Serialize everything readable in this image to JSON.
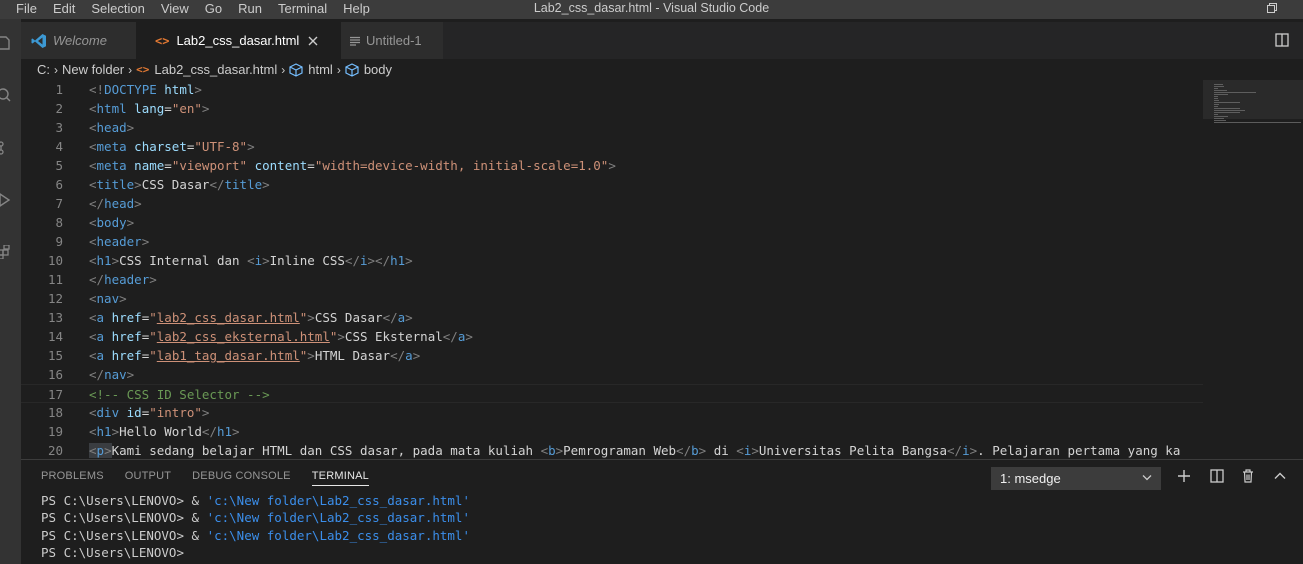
{
  "titlebar": {
    "menu": [
      "File",
      "Edit",
      "Selection",
      "View",
      "Go",
      "Run",
      "Terminal",
      "Help"
    ],
    "window_title": "Lab2_css_dasar.html - Visual Studio Code"
  },
  "tabs": [
    {
      "label": "Welcome",
      "icon": "vscode-logo-icon"
    },
    {
      "label": "Lab2_css_dasar.html",
      "icon": "html-file-icon",
      "active": true
    },
    {
      "label": "Untitled-1",
      "icon": "text-file-icon"
    }
  ],
  "breadcrumb": [
    "C:",
    "New folder",
    "Lab2_css_dasar.html",
    "html",
    "body"
  ],
  "editor": {
    "line_numbers": [
      "1",
      "2",
      "3",
      "4",
      "5",
      "6",
      "7",
      "8",
      "9",
      "10",
      "11",
      "12",
      "13",
      "14",
      "15",
      "16",
      "17",
      "18",
      "19",
      "20"
    ],
    "lines": [
      [
        [
          "t-tag",
          "<!"
        ],
        [
          "t-name",
          "DOCTYPE"
        ],
        [
          "t-text",
          " "
        ],
        [
          "t-attr",
          "html"
        ],
        [
          "t-tag",
          ">"
        ]
      ],
      [
        [
          "t-tag",
          "<"
        ],
        [
          "t-name",
          "html"
        ],
        [
          "t-text",
          " "
        ],
        [
          "t-attr",
          "lang"
        ],
        [
          "t-text",
          "="
        ],
        [
          "t-str",
          "\"en\""
        ],
        [
          "t-tag",
          ">"
        ]
      ],
      [
        [
          "t-tag",
          "<"
        ],
        [
          "t-name",
          "head"
        ],
        [
          "t-tag",
          ">"
        ]
      ],
      [
        [
          "t-tag",
          "<"
        ],
        [
          "t-name",
          "meta"
        ],
        [
          "t-text",
          " "
        ],
        [
          "t-attr",
          "charset"
        ],
        [
          "t-text",
          "="
        ],
        [
          "t-str",
          "\"UTF-8\""
        ],
        [
          "t-tag",
          ">"
        ]
      ],
      [
        [
          "t-tag",
          "<"
        ],
        [
          "t-name",
          "meta"
        ],
        [
          "t-text",
          " "
        ],
        [
          "t-attr",
          "name"
        ],
        [
          "t-text",
          "="
        ],
        [
          "t-str",
          "\"viewport\""
        ],
        [
          "t-text",
          " "
        ],
        [
          "t-attr",
          "content"
        ],
        [
          "t-text",
          "="
        ],
        [
          "t-str",
          "\"width=device-width, initial-scale=1.0\""
        ],
        [
          "t-tag",
          ">"
        ]
      ],
      [
        [
          "t-tag",
          "<"
        ],
        [
          "t-name",
          "title"
        ],
        [
          "t-tag",
          ">"
        ],
        [
          "t-text",
          "CSS Dasar"
        ],
        [
          "t-tag",
          "</"
        ],
        [
          "t-name",
          "title"
        ],
        [
          "t-tag",
          ">"
        ]
      ],
      [
        [
          "t-tag",
          "</"
        ],
        [
          "t-name",
          "head"
        ],
        [
          "t-tag",
          ">"
        ]
      ],
      [
        [
          "t-tag",
          "<"
        ],
        [
          "t-name",
          "body"
        ],
        [
          "t-tag",
          ">"
        ]
      ],
      [
        [
          "t-tag",
          "<"
        ],
        [
          "t-name",
          "header"
        ],
        [
          "t-tag",
          ">"
        ]
      ],
      [
        [
          "t-tag",
          "<"
        ],
        [
          "t-name",
          "h1"
        ],
        [
          "t-tag",
          ">"
        ],
        [
          "t-text",
          "CSS Internal dan "
        ],
        [
          "t-tag",
          "<"
        ],
        [
          "t-name",
          "i"
        ],
        [
          "t-tag",
          ">"
        ],
        [
          "t-text",
          "Inline CSS"
        ],
        [
          "t-tag",
          "</"
        ],
        [
          "t-name",
          "i"
        ],
        [
          "t-tag",
          "></"
        ],
        [
          "t-name",
          "h1"
        ],
        [
          "t-tag",
          ">"
        ]
      ],
      [
        [
          "t-tag",
          "</"
        ],
        [
          "t-name",
          "header"
        ],
        [
          "t-tag",
          ">"
        ]
      ],
      [
        [
          "t-tag",
          "<"
        ],
        [
          "t-name",
          "nav"
        ],
        [
          "t-tag",
          ">"
        ]
      ],
      [
        [
          "t-tag",
          "<"
        ],
        [
          "t-name",
          "a"
        ],
        [
          "t-text",
          " "
        ],
        [
          "t-attr",
          "href"
        ],
        [
          "t-text",
          "="
        ],
        [
          "t-str",
          "\""
        ],
        [
          "t-link",
          "lab2_css_dasar.html"
        ],
        [
          "t-str",
          "\""
        ],
        [
          "t-tag",
          ">"
        ],
        [
          "t-text",
          "CSS Dasar"
        ],
        [
          "t-tag",
          "</"
        ],
        [
          "t-name",
          "a"
        ],
        [
          "t-tag",
          ">"
        ]
      ],
      [
        [
          "t-tag",
          "<"
        ],
        [
          "t-name",
          "a"
        ],
        [
          "t-text",
          " "
        ],
        [
          "t-attr",
          "href"
        ],
        [
          "t-text",
          "="
        ],
        [
          "t-str",
          "\""
        ],
        [
          "t-link",
          "lab2_css_eksternal.html"
        ],
        [
          "t-str",
          "\""
        ],
        [
          "t-tag",
          ">"
        ],
        [
          "t-text",
          "CSS Eksternal"
        ],
        [
          "t-tag",
          "</"
        ],
        [
          "t-name",
          "a"
        ],
        [
          "t-tag",
          ">"
        ]
      ],
      [
        [
          "t-tag",
          "<"
        ],
        [
          "t-name",
          "a"
        ],
        [
          "t-text",
          " "
        ],
        [
          "t-attr",
          "href"
        ],
        [
          "t-text",
          "="
        ],
        [
          "t-str",
          "\""
        ],
        [
          "t-link",
          "lab1_tag_dasar.html"
        ],
        [
          "t-str",
          "\""
        ],
        [
          "t-tag",
          ">"
        ],
        [
          "t-text",
          "HTML Dasar"
        ],
        [
          "t-tag",
          "</"
        ],
        [
          "t-name",
          "a"
        ],
        [
          "t-tag",
          ">"
        ]
      ],
      [
        [
          "t-tag",
          "</"
        ],
        [
          "t-name",
          "nav"
        ],
        [
          "t-tag",
          ">"
        ]
      ],
      [
        [
          "t-com",
          "<!-- CSS ID Selector -->"
        ]
      ],
      [
        [
          "t-tag",
          "<"
        ],
        [
          "t-name",
          "div"
        ],
        [
          "t-text",
          " "
        ],
        [
          "t-attr",
          "id"
        ],
        [
          "t-text",
          "="
        ],
        [
          "t-str",
          "\"intro\""
        ],
        [
          "t-tag",
          ">"
        ]
      ],
      [
        [
          "t-tag",
          "<"
        ],
        [
          "t-name",
          "h1"
        ],
        [
          "t-tag",
          ">"
        ],
        [
          "t-text",
          "Hello World"
        ],
        [
          "t-tag",
          "</"
        ],
        [
          "t-name",
          "h1"
        ],
        [
          "t-tag",
          ">"
        ]
      ],
      [
        [
          "t-tag",
          "<"
        ],
        [
          "t-name",
          "p"
        ],
        [
          "t-tag",
          ">"
        ],
        [
          "t-text",
          "Kami sedang belajar HTML dan CSS dasar, pada mata kuliah "
        ],
        [
          "t-tag",
          "<"
        ],
        [
          "t-name",
          "b"
        ],
        [
          "t-tag",
          ">"
        ],
        [
          "t-text",
          "Pemrograman Web"
        ],
        [
          "t-tag",
          "</"
        ],
        [
          "t-name",
          "b"
        ],
        [
          "t-tag",
          ">"
        ],
        [
          "t-text",
          " di "
        ],
        [
          "t-tag",
          "<"
        ],
        [
          "t-name",
          "i"
        ],
        [
          "t-tag",
          ">"
        ],
        [
          "t-text",
          "Universitas Pelita Bangsa"
        ],
        [
          "t-tag",
          "</"
        ],
        [
          "t-name",
          "i"
        ],
        [
          "t-tag",
          ">"
        ],
        [
          "t-text",
          ". Pelajaran pertama yang ka"
        ]
      ]
    ]
  },
  "panel": {
    "tabs": [
      "PROBLEMS",
      "OUTPUT",
      "DEBUG CONSOLE",
      "TERMINAL"
    ],
    "active_tab": "TERMINAL",
    "terminal_select": "1: msedge",
    "terminal_lines": [
      {
        "prompt": "PS C:\\Users\\LENOVO> & ",
        "path": "'c:\\New folder\\Lab2_css_dasar.html'"
      },
      {
        "prompt": "PS C:\\Users\\LENOVO> & ",
        "path": "'c:\\New folder\\Lab2_css_dasar.html'"
      },
      {
        "prompt": "PS C:\\Users\\LENOVO> & ",
        "path": "'c:\\New folder\\Lab2_css_dasar.html'"
      },
      {
        "prompt": "PS C:\\Users\\LENOVO>",
        "path": ""
      }
    ]
  },
  "colors": {
    "editor_bg": "#1e1e1e",
    "titlebar_bg": "#3c3c3c",
    "activity_bg": "#333333",
    "tag_name": "#569cd6",
    "attribute": "#9cdcfe",
    "string": "#ce9178",
    "comment": "#6a9955",
    "terminal_path": "#3b8eea"
  }
}
